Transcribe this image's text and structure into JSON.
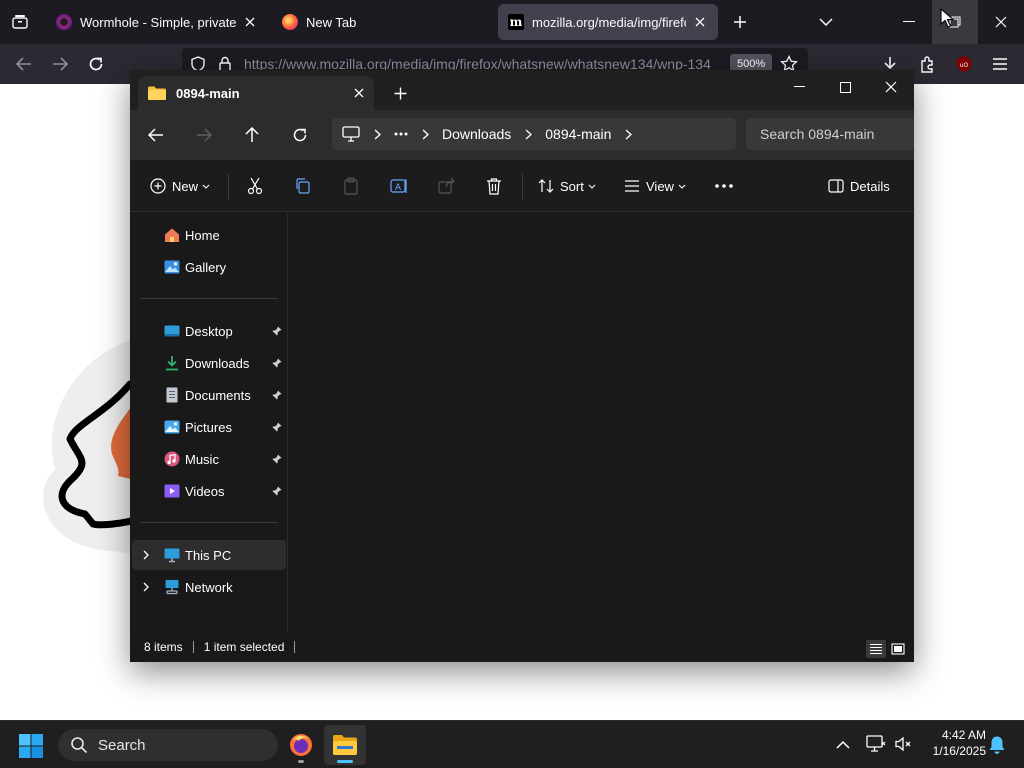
{
  "firefox": {
    "tabs": [
      {
        "title": "Wormhole - Simple, private file"
      },
      {
        "title": "New Tab"
      },
      {
        "title": "mozilla.org/media/img/firefox/"
      }
    ],
    "url": "https://www.mozilla.org/media/img/firefox/whatsnew/whatsnew134/wnp-134",
    "zoom": "500%"
  },
  "explorer": {
    "tab_title": "0894-main",
    "breadcrumb": [
      "Downloads",
      "0894-main"
    ],
    "search_placeholder": "Search 0894-main",
    "commands": {
      "new_label": "New",
      "sort_label": "Sort",
      "view_label": "View",
      "details_label": "Details"
    },
    "sidebar": {
      "top": [
        {
          "label": "Home",
          "icon": "home-icon"
        },
        {
          "label": "Gallery",
          "icon": "gallery-icon"
        }
      ],
      "quick_access": [
        {
          "label": "Desktop",
          "icon": "desktop-icon"
        },
        {
          "label": "Downloads",
          "icon": "downloads-icon"
        },
        {
          "label": "Documents",
          "icon": "documents-icon"
        },
        {
          "label": "Pictures",
          "icon": "pictures-icon"
        },
        {
          "label": "Music",
          "icon": "music-icon"
        },
        {
          "label": "Videos",
          "icon": "videos-icon"
        }
      ],
      "locations": [
        {
          "label": "This PC",
          "icon": "this-pc-icon"
        },
        {
          "label": "Network",
          "icon": "network-icon"
        }
      ]
    },
    "status": {
      "items_count": "8 items",
      "selected": "1 item selected"
    }
  },
  "taskbar": {
    "search_label": "Search",
    "time": "4:42 AM",
    "date": "1/16/2025"
  },
  "colors": {
    "firefox_tabbar": "#1c1b22",
    "firefox_navbar": "#2b2a33",
    "explorer_bg": "#191919",
    "windows_accent": "#0078d4",
    "folder_yellow": "#f5c13c"
  }
}
